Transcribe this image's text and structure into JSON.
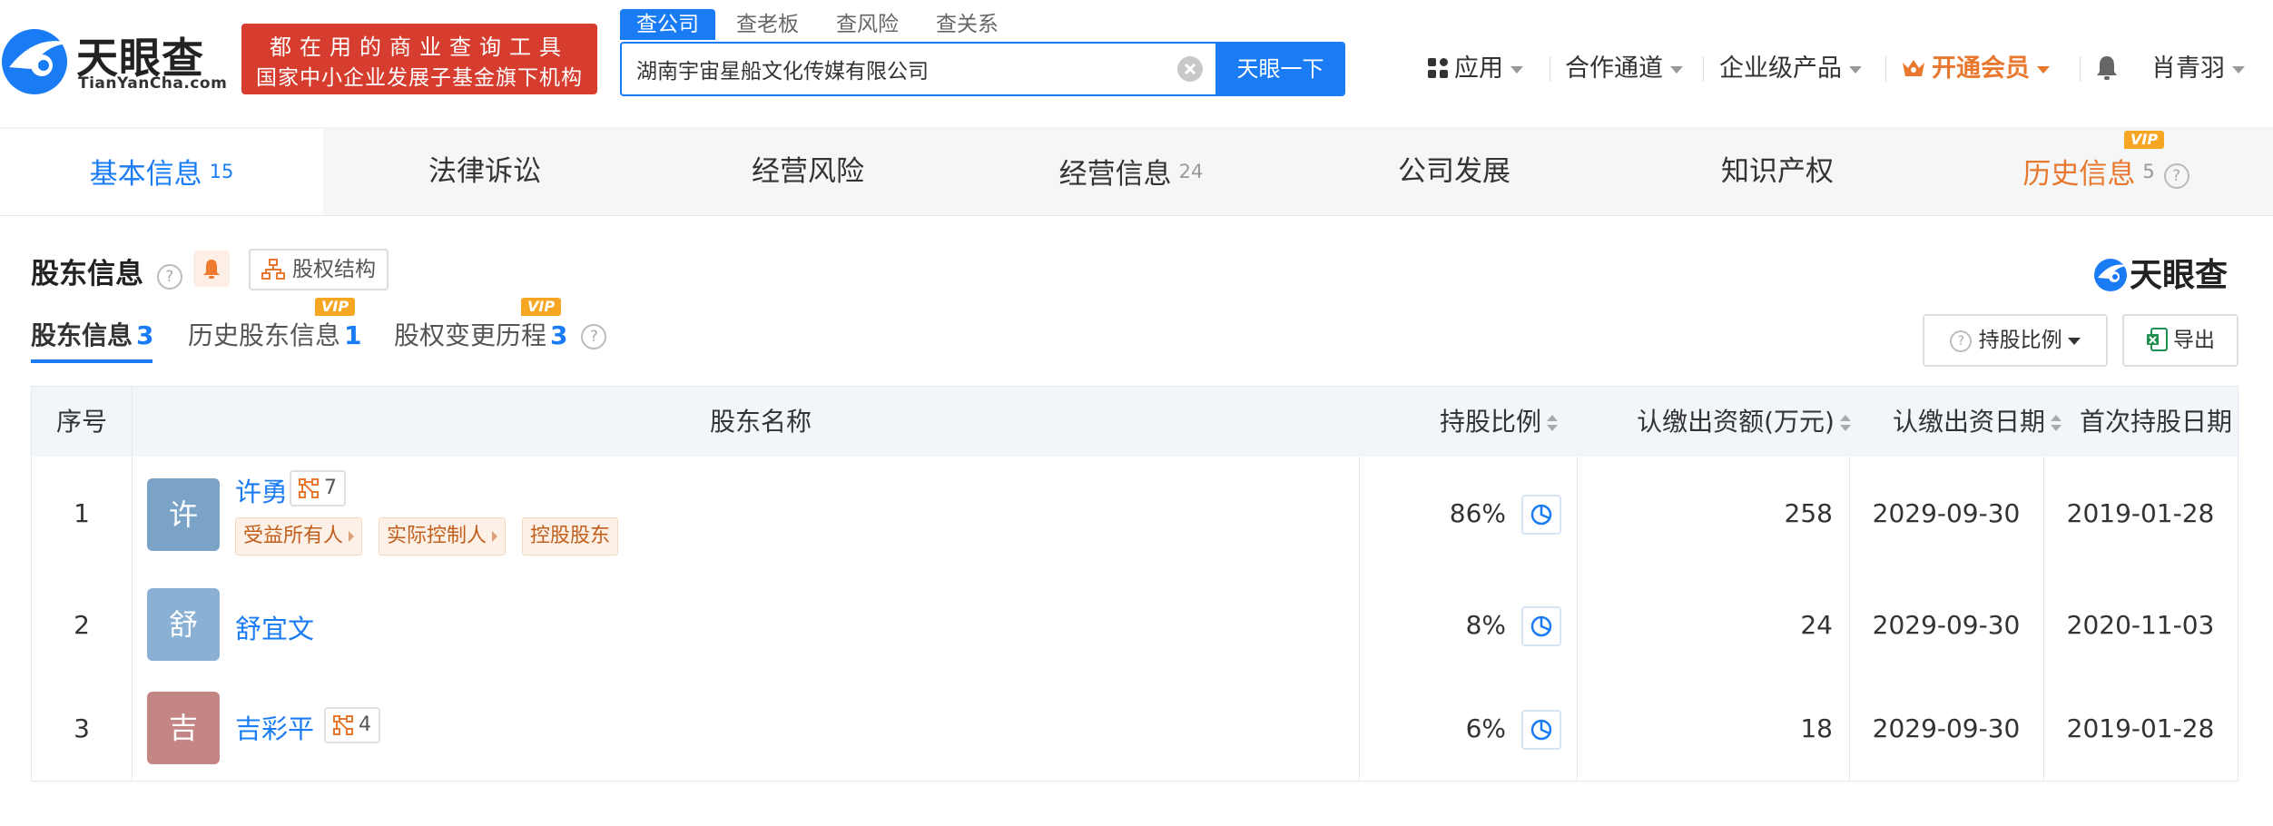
{
  "header": {
    "logo_text": "天眼查",
    "logo_sub": "TianYanCha.com",
    "banner_line1": "都在用的商业查询工具",
    "banner_line2": "国家中小企业发展子基金旗下机构",
    "search_tabs": [
      "查公司",
      "查老板",
      "查风险",
      "查关系"
    ],
    "search_value": "湖南宇宙星船文化传媒有限公司",
    "search_button": "天眼一下",
    "nav": {
      "apps": "应用",
      "partner": "合作通道",
      "enterprise": "企业级产品",
      "vip": "开通会员",
      "user": "肖青羽"
    }
  },
  "tabs": [
    {
      "label": "基本信息",
      "count": "15"
    },
    {
      "label": "法律诉讼",
      "count": ""
    },
    {
      "label": "经营风险",
      "count": ""
    },
    {
      "label": "经营信息",
      "count": "24"
    },
    {
      "label": "公司发展",
      "count": ""
    },
    {
      "label": "知识产权",
      "count": ""
    },
    {
      "label": "历史信息",
      "count": "5",
      "vip": "VIP"
    }
  ],
  "section": {
    "title": "股东信息",
    "structure_button": "股权结构",
    "brand": "天眼查",
    "subtabs": [
      {
        "label": "股东信息",
        "count": "3"
      },
      {
        "label": "历史股东信息",
        "count": "1",
        "vip": "VIP"
      },
      {
        "label": "股权变更历程",
        "count": "3",
        "vip": "VIP"
      }
    ],
    "ratio_button": "持股比例",
    "export_button": "导出"
  },
  "table": {
    "headers": [
      "序号",
      "股东名称",
      "持股比例",
      "认缴出资额(万元)",
      "认缴出资日期",
      "首次持股日期"
    ],
    "rows": [
      {
        "index": "1",
        "avatar": "许",
        "avatar_color": "#7ba3c8",
        "name": "许勇",
        "relation_count": "7",
        "tags": [
          "受益所有人",
          "实际控制人",
          "控股股东"
        ],
        "ratio": "86%",
        "amount": "258",
        "subscribe_date": "2029-09-30",
        "first_date": "2019-01-28"
      },
      {
        "index": "2",
        "avatar": "舒",
        "avatar_color": "#8ab0d4",
        "name": "舒宜文",
        "relation_count": "",
        "tags": [],
        "ratio": "8%",
        "amount": "24",
        "subscribe_date": "2029-09-30",
        "first_date": "2020-11-03"
      },
      {
        "index": "3",
        "avatar": "吉",
        "avatar_color": "#c48585",
        "name": "吉彩平",
        "relation_count": "4",
        "tags": [],
        "ratio": "6%",
        "amount": "18",
        "subscribe_date": "2029-09-30",
        "first_date": "2019-01-28"
      }
    ]
  },
  "colors": {
    "primary": "#1a7cf5",
    "banner": "#d63d2e",
    "vip_orange": "#e8782e"
  }
}
